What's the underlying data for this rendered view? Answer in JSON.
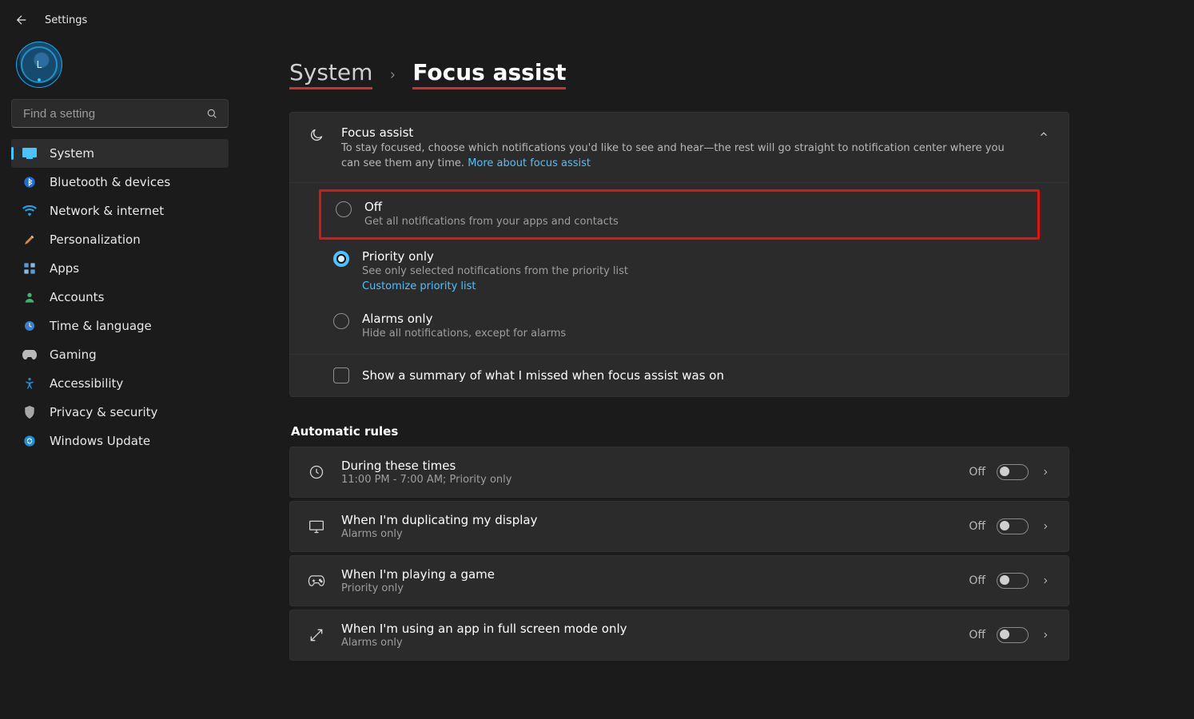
{
  "app_title": "Settings",
  "search": {
    "placeholder": "Find a setting"
  },
  "sidebar": {
    "items": [
      {
        "label": "System"
      },
      {
        "label": "Bluetooth & devices"
      },
      {
        "label": "Network & internet"
      },
      {
        "label": "Personalization"
      },
      {
        "label": "Apps"
      },
      {
        "label": "Accounts"
      },
      {
        "label": "Time & language"
      },
      {
        "label": "Gaming"
      },
      {
        "label": "Accessibility"
      },
      {
        "label": "Privacy & security"
      },
      {
        "label": "Windows Update"
      }
    ]
  },
  "breadcrumb": {
    "parent": "System",
    "child": "Focus assist"
  },
  "focus_card": {
    "title": "Focus assist",
    "desc_pre": "To stay focused, choose which notifications you'd like to see and hear—the rest will go straight to notification center where you can see them any time.  ",
    "link": "More about focus assist"
  },
  "options": [
    {
      "title": "Off",
      "desc": "Get all notifications from your apps and contacts"
    },
    {
      "title": "Priority only",
      "desc": "See only selected notifications from the priority list",
      "link": "Customize priority list"
    },
    {
      "title": "Alarms only",
      "desc": "Hide all notifications, except for alarms"
    }
  ],
  "summary_checkbox": "Show a summary of what I missed when focus assist was on",
  "rules_title": "Automatic rules",
  "rules": [
    {
      "title": "During these times",
      "desc": "11:00 PM - 7:00 AM; Priority only",
      "state": "Off"
    },
    {
      "title": "When I'm duplicating my display",
      "desc": "Alarms only",
      "state": "Off"
    },
    {
      "title": "When I'm playing a game",
      "desc": "Priority only",
      "state": "Off"
    },
    {
      "title": "When I'm using an app in full screen mode only",
      "desc": "Alarms only",
      "state": "Off"
    }
  ]
}
